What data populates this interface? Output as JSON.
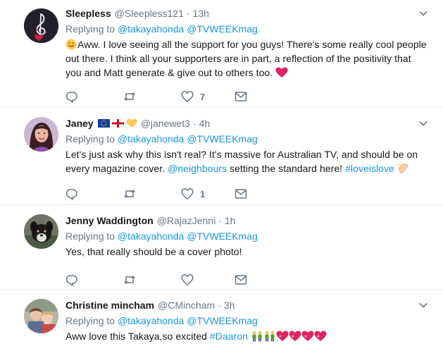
{
  "tweets": [
    {
      "name": "Sleepless",
      "handle": "@Sleepless121",
      "time": "13h",
      "replying_prefix": "Replying to ",
      "mentions": [
        "@takayahonda",
        "@TVWEEKmag"
      ],
      "text_1": "Aww. I love seeing all the support for you guys! There's some really cool people out there. I think all your supporters are in part, a reflection of the positivity that you and Matt generate & give out to others too. ",
      "likes": "7",
      "avatar_icon": "treble-clef-heart-avatar"
    },
    {
      "name": "Janey",
      "handle": "@janewet3",
      "time": "4h",
      "replying_prefix": "Replying to ",
      "mentions": [
        "@takayahonda",
        "@TVWEEKmag"
      ],
      "text_1": "Let's just ask why this isn't real? It's massive for Australian TV, and should be on every magazine cover. ",
      "link_1": "@neighbours",
      "text_2": " setting the standard here! ",
      "link_2": "#loveislove",
      "likes": "1",
      "avatar_icon": "woman-portrait-avatar"
    },
    {
      "name": "Jenny Waddington",
      "handle": "@RajazJenni",
      "time": "1h",
      "replying_prefix": "Replying to ",
      "mentions": [
        "@takayahonda",
        "@TVWEEKmag"
      ],
      "text_1": "Yes, that really should be a cover photo!",
      "avatar_icon": "dog-photo-avatar"
    },
    {
      "name": "Christine mincham",
      "handle": "@CMincham",
      "time": "3h",
      "replying_prefix": "Replying to ",
      "mentions": [
        "@takayahonda",
        "@TVWEEKmag"
      ],
      "text_1": "Aww love this Takaya,so excited ",
      "link_1": "#Daaron",
      "avatar_icon": "children-photo-avatar"
    }
  ],
  "separator": "·",
  "colors": {
    "link": "#1b95e0",
    "secondary_text": "#657786",
    "primary_text": "#14171a",
    "divider": "#e6ecf0",
    "heart_emoji": "#e0245e"
  },
  "action_icons": [
    "reply-icon",
    "retweet-icon",
    "like-icon",
    "direct-message-icon"
  ]
}
